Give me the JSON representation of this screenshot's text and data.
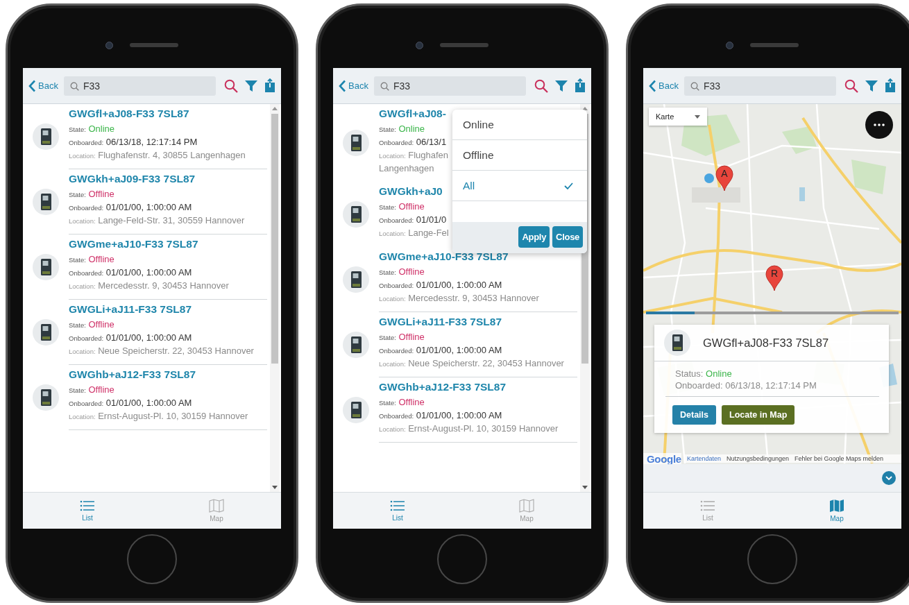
{
  "phones": [
    {
      "kind": "list",
      "header": {
        "back": "Back",
        "search": "F33"
      },
      "devices": [
        {
          "name": "GWGfl+aJ08-F33 7SL87",
          "state_label": "State:",
          "state": "Online",
          "online": true,
          "onboarded_label": "Onboarded:",
          "onboarded": "06/13/18, 12:17:14 PM",
          "location_label": "Location:",
          "location": "Flughafenstr. 4, 30855 Langenhagen"
        },
        {
          "name": "GWGkh+aJ09-F33 7SL87",
          "state_label": "State:",
          "state": "Offline",
          "online": false,
          "onboarded_label": "Onboarded:",
          "onboarded": "01/01/00, 1:00:00 AM",
          "location_label": "Location:",
          "location": "Lange-Feld-Str. 31, 30559 Hannover"
        },
        {
          "name": "GWGme+aJ10-F33 7SL87",
          "state_label": "State:",
          "state": "Offline",
          "online": false,
          "onboarded_label": "Onboarded:",
          "onboarded": "01/01/00, 1:00:00 AM",
          "location_label": "Location:",
          "location": "Mercedesstr. 9, 30453 Hannover"
        },
        {
          "name": "GWGLi+aJ11-F33 7SL87",
          "state_label": "State:",
          "state": "Offline",
          "online": false,
          "onboarded_label": "Onboarded:",
          "onboarded": "01/01/00, 1:00:00 AM",
          "location_label": "Location:",
          "location": "Neue Speicherstr. 22, 30453 Hannover"
        },
        {
          "name": "GWGhb+aJ12-F33 7SL87",
          "state_label": "State:",
          "state": "Offline",
          "online": false,
          "onboarded_label": "Onboarded:",
          "onboarded": "01/01/00, 1:00:00 AM",
          "location_label": "Location:",
          "location": "Ernst-August-Pl. 10, 30159 Hannover"
        }
      ],
      "tabs": [
        {
          "label": "List",
          "selected": true
        },
        {
          "label": "Map",
          "selected": false
        }
      ]
    },
    {
      "kind": "list",
      "header": {
        "back": "Back",
        "search": "F33"
      },
      "devices": [
        {
          "name": "GWGfl+aJ08-",
          "state_label": "State:",
          "state": "Online",
          "online": true,
          "onboarded_label": "Onboarded:",
          "onboarded": "06/13/1",
          "location_label": "Location:",
          "location": "Flughafen Langenhagen"
        },
        {
          "name": "GWGkh+aJ0",
          "state_label": "State:",
          "state": "Offline",
          "online": false,
          "onboarded_label": "Onboarded:",
          "onboarded": "01/01/0",
          "location_label": "Location:",
          "location": "Lange-Fel"
        },
        {
          "name": "GWGme+aJ10-F33 7SL87",
          "state_label": "State:",
          "state": "Offline",
          "online": false,
          "onboarded_label": "Onboarded:",
          "onboarded": "01/01/00, 1:00:00 AM",
          "location_label": "Location:",
          "location": "Mercedesstr. 9, 30453 Hannover"
        },
        {
          "name": "GWGLi+aJ11-F33 7SL87",
          "state_label": "State:",
          "state": "Offline",
          "online": false,
          "onboarded_label": "Onboarded:",
          "onboarded": "01/01/00, 1:00:00 AM",
          "location_label": "Location:",
          "location": "Neue Speicherstr. 22, 30453 Hannover"
        },
        {
          "name": "GWGhb+aJ12-F33 7SL87",
          "state_label": "State:",
          "state": "Offline",
          "online": false,
          "onboarded_label": "Onboarded:",
          "onboarded": "01/01/00, 1:00:00 AM",
          "location_label": "Location:",
          "location": "Ernst-August-Pl. 10, 30159 Hannover"
        }
      ],
      "filter_menu": {
        "options": [
          {
            "label": "Online",
            "selected": false
          },
          {
            "label": "Offline",
            "selected": false
          },
          {
            "label": "All",
            "selected": true
          }
        ],
        "buttons": [
          {
            "label": "Apply"
          },
          {
            "label": "Close"
          }
        ]
      },
      "tabs": [
        {
          "label": "List",
          "selected": true
        },
        {
          "label": "Map",
          "selected": false
        }
      ]
    },
    {
      "kind": "map",
      "header": {
        "back": "Back",
        "search": "F33"
      },
      "map": {
        "map_type": "Karte",
        "pins": [
          {
            "label": "A"
          },
          {
            "label": "R"
          }
        ],
        "popup": {
          "title": "GWGfl+aJ08-F33 7SL87",
          "status_label": "Status:",
          "status": "Online",
          "online": true,
          "onboarded_label": "Onboarded:",
          "onboarded": "06/13/18, 12:17:14 PM",
          "buttons": [
            {
              "label": "Details",
              "color": "#2481a8"
            },
            {
              "label": "Locate in Map",
              "color": "#5b6f22"
            }
          ]
        },
        "logo": "Google",
        "attribution": [
          "Kartendaten",
          "Nutzungsbedingungen",
          "Fehler bei Google Maps melden"
        ]
      },
      "tabs": [
        {
          "label": "List",
          "selected": false
        },
        {
          "label": "Map",
          "selected": true
        }
      ]
    }
  ]
}
